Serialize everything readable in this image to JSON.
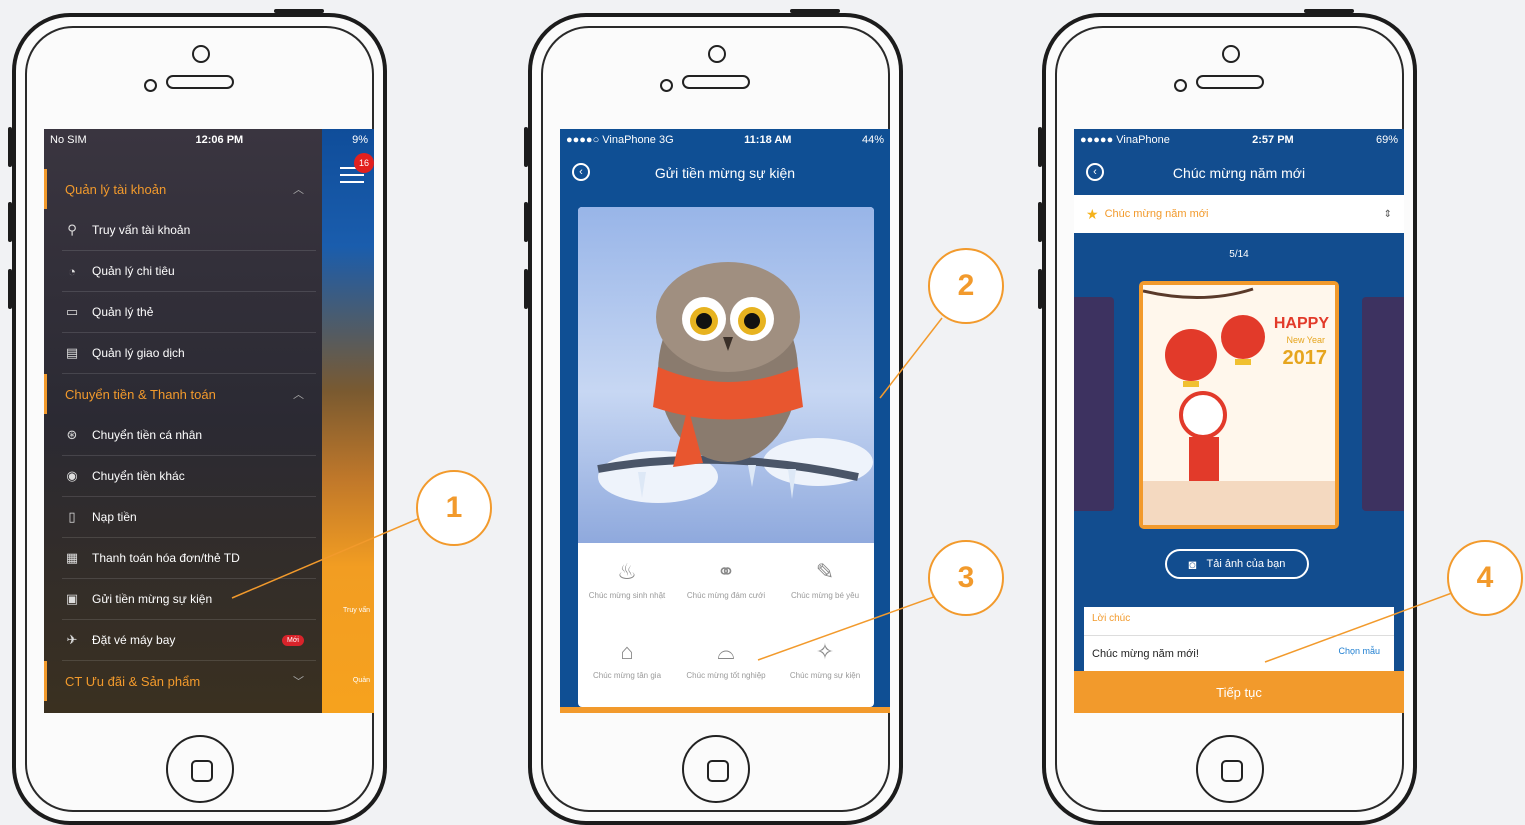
{
  "phone1": {
    "status": {
      "carrier": "No SIM",
      "time": "12:06 PM",
      "battery": "9%"
    },
    "notification_count": "16",
    "sections": [
      {
        "title": "Quản lý tài khoản",
        "items": [
          "Truy vấn tài khoản",
          "Quản lý chi tiêu",
          "Quản lý thẻ",
          "Quản lý giao dịch"
        ]
      },
      {
        "title": "Chuyển tiền & Thanh toán",
        "items": [
          "Chuyển tiền cá nhân",
          "Chuyển tiền khác",
          "Nạp tiền",
          "Thanh toán hóa đơn/thẻ TD",
          "Gửi tiền mừng sự kiện",
          "Đặt vé máy bay"
        ]
      },
      {
        "title": "CT Ưu đãi & Sản phẩm",
        "items": []
      }
    ],
    "new_badge": "Mới",
    "side_label_1": "Truy vấn",
    "side_label_2": "Quản"
  },
  "phone2": {
    "status": {
      "carrier": "●●●●○ VinaPhone 3G",
      "time": "11:18 AM",
      "battery": "44%"
    },
    "title": "Gửi tiền mừng sự kiện",
    "options": [
      {
        "label": "Chúc mừng sinh nhật",
        "icon": "cake-icon"
      },
      {
        "label": "Chúc mừng đám cưới",
        "icon": "rings-icon"
      },
      {
        "label": "Chúc mừng bé yêu",
        "icon": "bottle-icon"
      },
      {
        "label": "Chúc mừng tân gia",
        "icon": "house-icon"
      },
      {
        "label": "Chúc mừng tốt nghiệp",
        "icon": "graduation-cap-icon"
      },
      {
        "label": "Chúc mừng sự kiện",
        "icon": "party-icon"
      }
    ]
  },
  "phone3": {
    "status": {
      "carrier": "●●●●● VinaPhone",
      "time": "2:57 PM",
      "battery": "69%"
    },
    "title": "Chúc mừng năm mới",
    "dropdown_value": "Chúc mừng năm mới",
    "counter": "5/14",
    "card_text_1": "HAPPY",
    "card_text_2": "New Year",
    "card_text_3": "2017",
    "photo_button": "Tải ảnh của bạn",
    "message_label": "Lời chúc",
    "message_value": "Chúc mừng năm mới!",
    "template_link": "Chọn mẫu",
    "continue_button": "Tiếp tục"
  },
  "callouts": [
    "1",
    "2",
    "3",
    "4"
  ],
  "colors": {
    "accent": "#f29a2c",
    "primary": "#0f4f94"
  }
}
